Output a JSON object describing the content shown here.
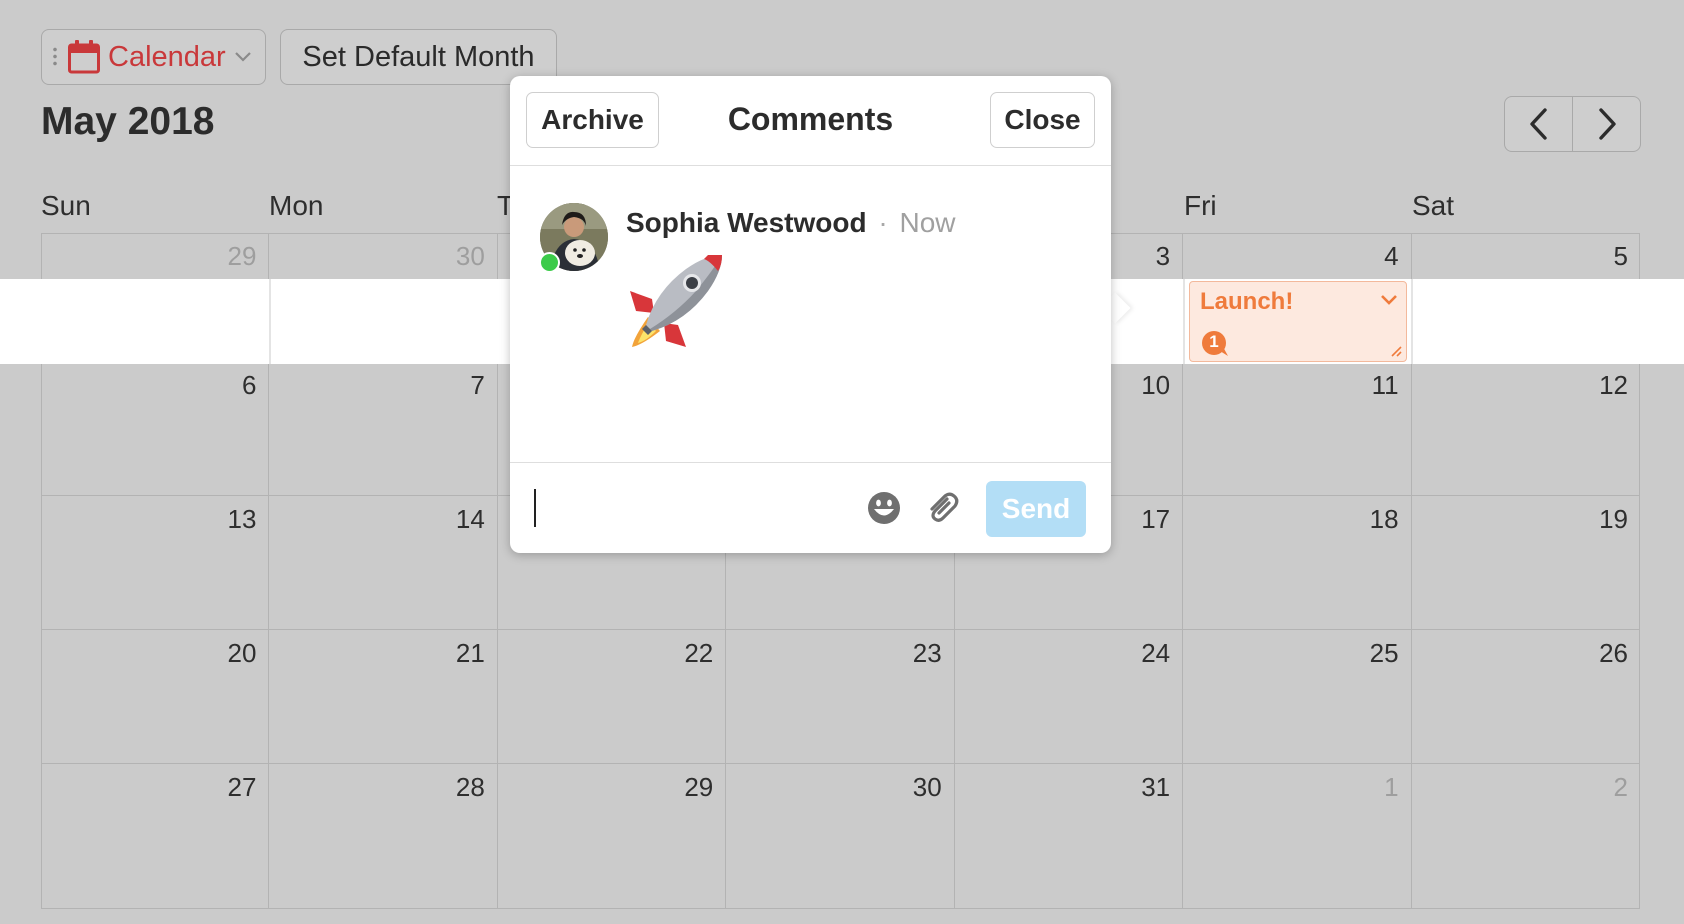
{
  "toolbar": {
    "calendar_dropdown": "Calendar",
    "set_default_month": "Set Default Month"
  },
  "month_title": "May 2018",
  "weekdays": [
    "Sun",
    "Mon",
    "T",
    "",
    "",
    "Fri",
    "Sat"
  ],
  "weeks": [
    [
      "29",
      "30",
      "",
      "",
      "3",
      "4",
      "5"
    ],
    [
      "6",
      "7",
      "",
      "",
      "10",
      "11",
      "12"
    ],
    [
      "13",
      "14",
      "",
      "",
      "17",
      "18",
      "19"
    ],
    [
      "20",
      "21",
      "22",
      "23",
      "24",
      "25",
      "26"
    ],
    [
      "27",
      "28",
      "29",
      "30",
      "31",
      "1",
      "2"
    ]
  ],
  "event": {
    "title": "Launch!",
    "comment_count": "1",
    "color": "#ef7b3c"
  },
  "popover": {
    "archive": "Archive",
    "title": "Comments",
    "close": "Close",
    "comment": {
      "author": "Sophia Westwood",
      "separator": "·",
      "time": "Now",
      "content": "rocket-emoji"
    },
    "composer": {
      "value": "",
      "send": "Send"
    }
  },
  "colors": {
    "calendar_accent": "#c9383a",
    "send_button": "#b3def6",
    "online": "#3ccb4a"
  }
}
